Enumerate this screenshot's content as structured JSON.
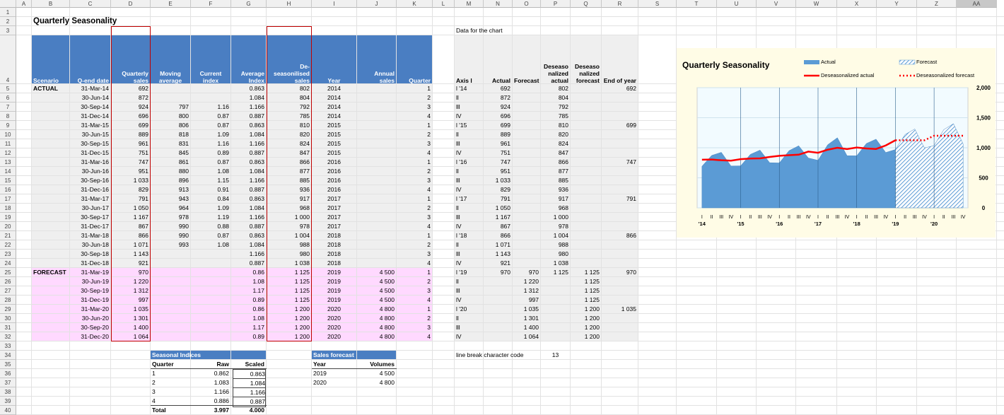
{
  "sheet": {
    "columns": [
      "A",
      "B",
      "C",
      "D",
      "E",
      "F",
      "G",
      "H",
      "I",
      "J",
      "K",
      "L",
      "M",
      "N",
      "O",
      "P",
      "Q",
      "R",
      "S",
      "T",
      "U",
      "V",
      "W",
      "X",
      "Y",
      "Z",
      "AA"
    ],
    "title": "Quarterly Seasonality",
    "data_for_chart_label": "Data for the chart",
    "headers": {
      "scenario": "Scenario",
      "qend": "Q-end date",
      "qsales": "Quarterly sales",
      "moving": "Moving average",
      "current": "Current index",
      "average": "Average Index",
      "deseas": "De-seasonilised sales",
      "year": "Year",
      "annual": "Annual sales",
      "quarter": "Quarter",
      "axis": "Axis l",
      "actual": "Actual",
      "forecast": "Forecast",
      "des_actual": "Deseaso nalized actual",
      "des_forecast": "Deseaso nalized forecast",
      "endofyear": "End of year"
    },
    "rows": [
      {
        "s": "ACTUAL",
        "d": "31-Mar-14",
        "qs": "692",
        "ma": "",
        "ci": "",
        "ai": "0.863",
        "ds": "802",
        "y": "2014",
        "as": "",
        "q": "1",
        "ax": "l '14",
        "na": "692",
        "of": "",
        "pa": "802",
        "qf": "",
        "r": "692"
      },
      {
        "s": "",
        "d": "30-Jun-14",
        "qs": "872",
        "ma": "",
        "ci": "",
        "ai": "1.084",
        "ds": "804",
        "y": "2014",
        "as": "",
        "q": "2",
        "ax": "ll",
        "na": "872",
        "of": "",
        "pa": "804",
        "qf": "",
        "r": ""
      },
      {
        "s": "",
        "d": "30-Sep-14",
        "qs": "924",
        "ma": "797",
        "ci": "1.16",
        "ai": "1.166",
        "ds": "792",
        "y": "2014",
        "as": "",
        "q": "3",
        "ax": "lll",
        "na": "924",
        "of": "",
        "pa": "792",
        "qf": "",
        "r": ""
      },
      {
        "s": "",
        "d": "31-Dec-14",
        "qs": "696",
        "ma": "800",
        "ci": "0.87",
        "ai": "0.887",
        "ds": "785",
        "y": "2014",
        "as": "",
        "q": "4",
        "ax": "lV",
        "na": "696",
        "of": "",
        "pa": "785",
        "qf": "",
        "r": ""
      },
      {
        "s": "",
        "d": "31-Mar-15",
        "qs": "699",
        "ma": "806",
        "ci": "0.87",
        "ai": "0.863",
        "ds": "810",
        "y": "2015",
        "as": "",
        "q": "1",
        "ax": "l '15",
        "na": "699",
        "of": "",
        "pa": "810",
        "qf": "",
        "r": "699"
      },
      {
        "s": "",
        "d": "30-Jun-15",
        "qs": "889",
        "ma": "818",
        "ci": "1.09",
        "ai": "1.084",
        "ds": "820",
        "y": "2015",
        "as": "",
        "q": "2",
        "ax": "ll",
        "na": "889",
        "of": "",
        "pa": "820",
        "qf": "",
        "r": ""
      },
      {
        "s": "",
        "d": "30-Sep-15",
        "qs": "961",
        "ma": "831",
        "ci": "1.16",
        "ai": "1.166",
        "ds": "824",
        "y": "2015",
        "as": "",
        "q": "3",
        "ax": "lll",
        "na": "961",
        "of": "",
        "pa": "824",
        "qf": "",
        "r": ""
      },
      {
        "s": "",
        "d": "31-Dec-15",
        "qs": "751",
        "ma": "845",
        "ci": "0.89",
        "ai": "0.887",
        "ds": "847",
        "y": "2015",
        "as": "",
        "q": "4",
        "ax": "lV",
        "na": "751",
        "of": "",
        "pa": "847",
        "qf": "",
        "r": ""
      },
      {
        "s": "",
        "d": "31-Mar-16",
        "qs": "747",
        "ma": "861",
        "ci": "0.87",
        "ai": "0.863",
        "ds": "866",
        "y": "2016",
        "as": "",
        "q": "1",
        "ax": "l '16",
        "na": "747",
        "of": "",
        "pa": "866",
        "qf": "",
        "r": "747"
      },
      {
        "s": "",
        "d": "30-Jun-16",
        "qs": "951",
        "ma": "880",
        "ci": "1.08",
        "ai": "1.084",
        "ds": "877",
        "y": "2016",
        "as": "",
        "q": "2",
        "ax": "ll",
        "na": "951",
        "of": "",
        "pa": "877",
        "qf": "",
        "r": ""
      },
      {
        "s": "",
        "d": "30-Sep-16",
        "qs": "1 033",
        "ma": "896",
        "ci": "1.15",
        "ai": "1.166",
        "ds": "885",
        "y": "2016",
        "as": "",
        "q": "3",
        "ax": "lll",
        "na": "1 033",
        "of": "",
        "pa": "885",
        "qf": "",
        "r": ""
      },
      {
        "s": "",
        "d": "31-Dec-16",
        "qs": "829",
        "ma": "913",
        "ci": "0.91",
        "ai": "0.887",
        "ds": "936",
        "y": "2016",
        "as": "",
        "q": "4",
        "ax": "lV",
        "na": "829",
        "of": "",
        "pa": "936",
        "qf": "",
        "r": ""
      },
      {
        "s": "",
        "d": "31-Mar-17",
        "qs": "791",
        "ma": "943",
        "ci": "0.84",
        "ai": "0.863",
        "ds": "917",
        "y": "2017",
        "as": "",
        "q": "1",
        "ax": "l '17",
        "na": "791",
        "of": "",
        "pa": "917",
        "qf": "",
        "r": "791"
      },
      {
        "s": "",
        "d": "30-Jun-17",
        "qs": "1 050",
        "ma": "964",
        "ci": "1.09",
        "ai": "1.084",
        "ds": "968",
        "y": "2017",
        "as": "",
        "q": "2",
        "ax": "ll",
        "na": "1 050",
        "of": "",
        "pa": "968",
        "qf": "",
        "r": ""
      },
      {
        "s": "",
        "d": "30-Sep-17",
        "qs": "1 167",
        "ma": "978",
        "ci": "1.19",
        "ai": "1.166",
        "ds": "1 000",
        "y": "2017",
        "as": "",
        "q": "3",
        "ax": "lll",
        "na": "1 167",
        "of": "",
        "pa": "1 000",
        "qf": "",
        "r": ""
      },
      {
        "s": "",
        "d": "31-Dec-17",
        "qs": "867",
        "ma": "990",
        "ci": "0.88",
        "ai": "0.887",
        "ds": "978",
        "y": "2017",
        "as": "",
        "q": "4",
        "ax": "lV",
        "na": "867",
        "of": "",
        "pa": "978",
        "qf": "",
        "r": ""
      },
      {
        "s": "",
        "d": "31-Mar-18",
        "qs": "866",
        "ma": "990",
        "ci": "0.87",
        "ai": "0.863",
        "ds": "1 004",
        "y": "2018",
        "as": "",
        "q": "1",
        "ax": "l '18",
        "na": "866",
        "of": "",
        "pa": "1 004",
        "qf": "",
        "r": "866"
      },
      {
        "s": "",
        "d": "30-Jun-18",
        "qs": "1 071",
        "ma": "993",
        "ci": "1.08",
        "ai": "1.084",
        "ds": "988",
        "y": "2018",
        "as": "",
        "q": "2",
        "ax": "ll",
        "na": "1 071",
        "of": "",
        "pa": "988",
        "qf": "",
        "r": ""
      },
      {
        "s": "",
        "d": "30-Sep-18",
        "qs": "1 143",
        "ma": "",
        "ci": "",
        "ai": "1.166",
        "ds": "980",
        "y": "2018",
        "as": "",
        "q": "3",
        "ax": "lll",
        "na": "1 143",
        "of": "",
        "pa": "980",
        "qf": "",
        "r": ""
      },
      {
        "s": "",
        "d": "31-Dec-18",
        "qs": "921",
        "ma": "",
        "ci": "",
        "ai": "0.887",
        "ds": "1 038",
        "y": "2018",
        "as": "",
        "q": "4",
        "ax": "lV",
        "na": "921",
        "of": "",
        "pa": "1 038",
        "qf": "",
        "r": ""
      },
      {
        "s": "FORECAST",
        "d": "31-Mar-19",
        "qs": "970",
        "ma": "",
        "ci": "",
        "ai": "0.86",
        "ds": "1 125",
        "y": "2019",
        "as": "4 500",
        "q": "1",
        "ax": "l '19",
        "na": "970",
        "of": "970",
        "pa": "1 125",
        "qf": "1 125",
        "r": "970"
      },
      {
        "s": "",
        "d": "30-Jun-19",
        "qs": "1 220",
        "ma": "",
        "ci": "",
        "ai": "1.08",
        "ds": "1 125",
        "y": "2019",
        "as": "4 500",
        "q": "2",
        "ax": "ll",
        "na": "",
        "of": "1 220",
        "pa": "",
        "qf": "1 125",
        "r": ""
      },
      {
        "s": "",
        "d": "30-Sep-19",
        "qs": "1 312",
        "ma": "",
        "ci": "",
        "ai": "1.17",
        "ds": "1 125",
        "y": "2019",
        "as": "4 500",
        "q": "3",
        "ax": "lll",
        "na": "",
        "of": "1 312",
        "pa": "",
        "qf": "1 125",
        "r": ""
      },
      {
        "s": "",
        "d": "31-Dec-19",
        "qs": "997",
        "ma": "",
        "ci": "",
        "ai": "0.89",
        "ds": "1 125",
        "y": "2019",
        "as": "4 500",
        "q": "4",
        "ax": "lV",
        "na": "",
        "of": "997",
        "pa": "",
        "qf": "1 125",
        "r": ""
      },
      {
        "s": "",
        "d": "31-Mar-20",
        "qs": "1 035",
        "ma": "",
        "ci": "",
        "ai": "0.86",
        "ds": "1 200",
        "y": "2020",
        "as": "4 800",
        "q": "1",
        "ax": "l '20",
        "na": "",
        "of": "1 035",
        "pa": "",
        "qf": "1 200",
        "r": "1 035"
      },
      {
        "s": "",
        "d": "30-Jun-20",
        "qs": "1 301",
        "ma": "",
        "ci": "",
        "ai": "1.08",
        "ds": "1 200",
        "y": "2020",
        "as": "4 800",
        "q": "2",
        "ax": "ll",
        "na": "",
        "of": "1 301",
        "pa": "",
        "qf": "1 200",
        "r": ""
      },
      {
        "s": "",
        "d": "30-Sep-20",
        "qs": "1 400",
        "ma": "",
        "ci": "",
        "ai": "1.17",
        "ds": "1 200",
        "y": "2020",
        "as": "4 800",
        "q": "3",
        "ax": "lll",
        "na": "",
        "of": "1 400",
        "pa": "",
        "qf": "1 200",
        "r": ""
      },
      {
        "s": "",
        "d": "31-Dec-20",
        "qs": "1 064",
        "ma": "",
        "ci": "",
        "ai": "0.89",
        "ds": "1 200",
        "y": "2020",
        "as": "4 800",
        "q": "4",
        "ax": "lV",
        "na": "",
        "of": "1 064",
        "pa": "",
        "qf": "1 200",
        "r": ""
      }
    ],
    "seasonal": {
      "title": "Seasonal Indices",
      "h_quarter": "Quarter",
      "h_raw": "Raw",
      "h_scaled": "Scaled",
      "rows": [
        [
          "1",
          "0.862",
          "0.863"
        ],
        [
          "2",
          "1.083",
          "1.084"
        ],
        [
          "3",
          "1.166",
          "1.166"
        ],
        [
          "4",
          "0.886",
          "0.887"
        ]
      ],
      "total_label": "Total",
      "total_raw": "3.997",
      "total_scaled": "4.000"
    },
    "sales_forecast": {
      "title": "Sales forecast",
      "h_year": "Year",
      "h_vol": "Volumes",
      "rows": [
        [
          "2019",
          "4 500"
        ],
        [
          "2020",
          "4 800"
        ]
      ]
    },
    "linebreak_label": "line break character code",
    "linebreak_value": "13"
  },
  "colors": {
    "header_blue": "#4a7ec2",
    "forecast_pink": "#ffd9ff",
    "gray_fill": "#efefef",
    "red_box": "#c00000",
    "bar_blue": "#5b9bd5",
    "deseas_red": "#ff0000",
    "chart_bg": "#fffce6"
  },
  "chart_data": {
    "type": "area",
    "title": "Quarterly Seasonality",
    "categories": [
      "I",
      "II",
      "III",
      "IV",
      "I",
      "II",
      "III",
      "IV",
      "I",
      "II",
      "III",
      "IV",
      "I",
      "II",
      "III",
      "IV",
      "I",
      "II",
      "III",
      "IV",
      "I",
      "II",
      "III",
      "IV",
      "I",
      "II",
      "III",
      "IV"
    ],
    "year_labels": [
      "'14",
      "'15",
      "'16",
      "'17",
      "'18",
      "'19",
      "'20"
    ],
    "series": [
      {
        "name": "Actual",
        "values": [
          692,
          872,
          924,
          696,
          699,
          889,
          961,
          751,
          747,
          951,
          1033,
          829,
          791,
          1050,
          1167,
          867,
          866,
          1071,
          1143,
          921,
          970,
          null,
          null,
          null,
          null,
          null,
          null,
          null
        ]
      },
      {
        "name": "Forecast",
        "values": [
          null,
          null,
          null,
          null,
          null,
          null,
          null,
          null,
          null,
          null,
          null,
          null,
          null,
          null,
          null,
          null,
          null,
          null,
          null,
          null,
          970,
          1220,
          1312,
          997,
          1035,
          1301,
          1400,
          1064
        ]
      },
      {
        "name": "Deseasonalized actual",
        "values": [
          802,
          804,
          792,
          785,
          810,
          820,
          824,
          847,
          866,
          877,
          885,
          936,
          917,
          968,
          1000,
          978,
          1004,
          988,
          980,
          1038,
          1125,
          null,
          null,
          null,
          null,
          null,
          null,
          null
        ]
      },
      {
        "name": "Deseasonalized forecast",
        "values": [
          null,
          null,
          null,
          null,
          null,
          null,
          null,
          null,
          null,
          null,
          null,
          null,
          null,
          null,
          null,
          null,
          null,
          null,
          null,
          null,
          1125,
          1125,
          1125,
          1125,
          1200,
          1200,
          1200,
          1200
        ]
      }
    ],
    "y_ticks": [
      "0",
      "500",
      "1,000",
      "1,500",
      "2,000"
    ],
    "ylim": [
      0,
      2000
    ],
    "grid": true,
    "legend": "top"
  }
}
